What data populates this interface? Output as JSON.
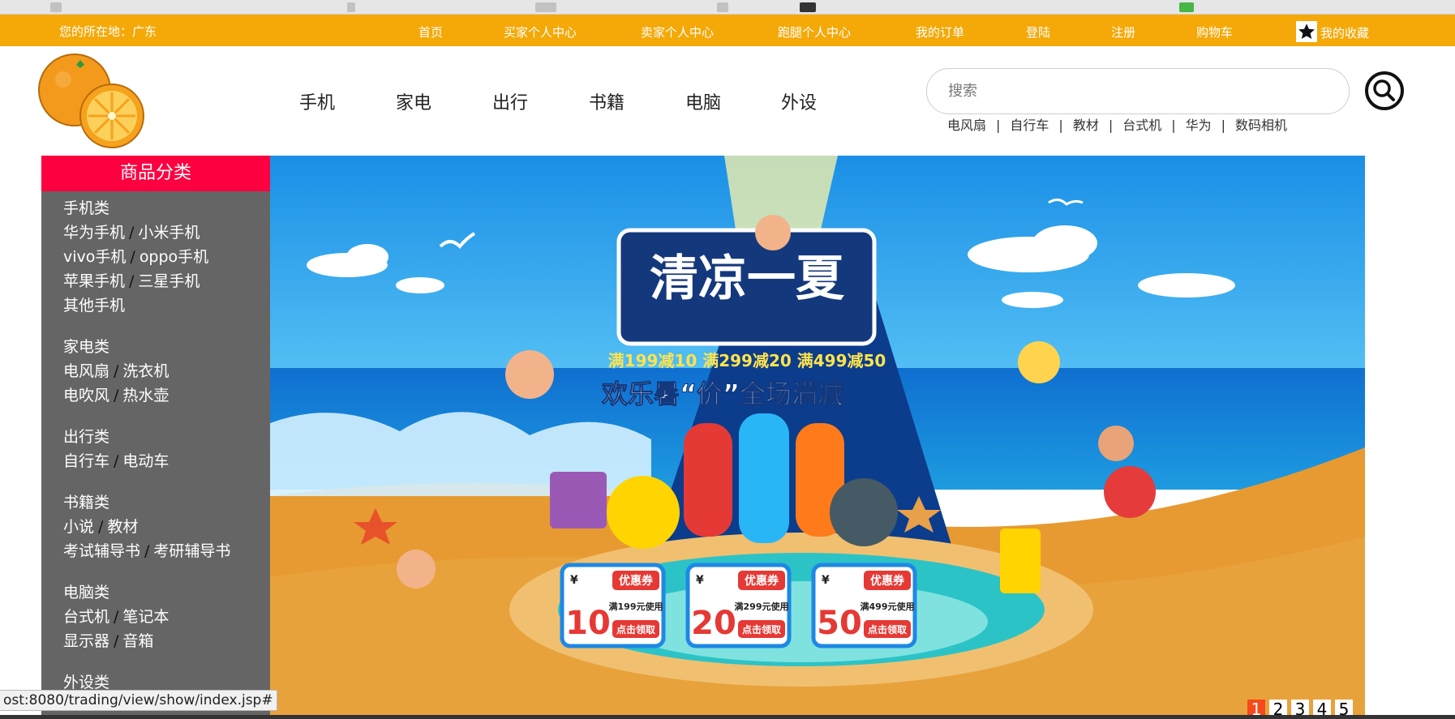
{
  "topbar": {
    "location_label": "您的所在地：广东",
    "links": [
      "首页",
      "买家个人中心",
      "卖家个人中心",
      "跑腿个人中心",
      "我的订单",
      "登陆",
      "注册",
      "购物车"
    ],
    "favorites_label": "我的收藏"
  },
  "nav": {
    "items": [
      "手机",
      "家电",
      "出行",
      "书籍",
      "电脑",
      "外设"
    ]
  },
  "search": {
    "placeholder": "搜索",
    "hot_keywords": [
      "电风扇",
      "自行车",
      "教材",
      "台式机",
      "华为",
      "数码相机"
    ]
  },
  "sidebar": {
    "title": "商品分类",
    "groups": [
      {
        "name": "手机类",
        "rows": [
          [
            "华为手机",
            "小米手机"
          ],
          [
            "vivo手机",
            "oppo手机"
          ],
          [
            "苹果手机",
            "三星手机"
          ],
          [
            "其他手机"
          ]
        ]
      },
      {
        "name": "家电类",
        "rows": [
          [
            "电风扇",
            "洗衣机"
          ],
          [
            "电吹风",
            "热水壶"
          ]
        ]
      },
      {
        "name": "出行类",
        "rows": [
          [
            "自行车",
            "电动车"
          ]
        ]
      },
      {
        "name": "书籍类",
        "rows": [
          [
            "小说",
            "教材"
          ],
          [
            "考试辅导书",
            "考研辅导书"
          ]
        ]
      },
      {
        "name": "电脑类",
        "rows": [
          [
            "台式机",
            "笔记本"
          ],
          [
            "显示器",
            "音箱"
          ]
        ]
      },
      {
        "name": "外设类",
        "rows": []
      }
    ]
  },
  "banner": {
    "headline": "清凉一夏",
    "promo_line": "满199减10 满299减20 满499减50",
    "slogan": "欢乐暑“价”全场满减",
    "coupons": [
      {
        "currency": "¥",
        "amount": "10",
        "title": "优惠券",
        "condition": "满199元使用",
        "action": "点击领取"
      },
      {
        "currency": "¥",
        "amount": "20",
        "title": "优惠券",
        "condition": "满299元使用",
        "action": "点击领取"
      },
      {
        "currency": "¥",
        "amount": "50",
        "title": "优惠券",
        "condition": "满499元使用",
        "action": "点击领取"
      }
    ],
    "pages": [
      "1",
      "2",
      "3",
      "4",
      "5"
    ],
    "active_page": "1"
  },
  "status_bar": {
    "url": "ost:8080/trading/view/show/index.jsp#"
  },
  "colors": {
    "topbar": "#f4a908",
    "sidebar": "#656565",
    "sidebar_title": "#fd0040",
    "pager_active": "#f54a1b"
  }
}
